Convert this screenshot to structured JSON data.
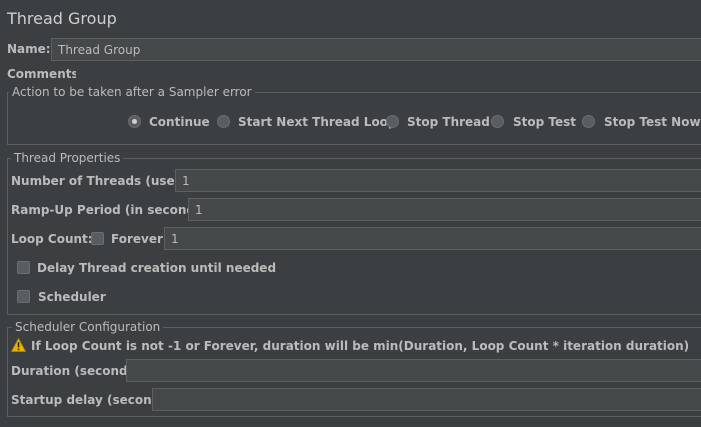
{
  "title": "Thread Group",
  "name_label": "Name:",
  "name_value": "Thread Group",
  "comments_label": "Comments:",
  "comments_value": "",
  "sampler_error": {
    "legend": "Action to be taken after a Sampler error",
    "options": [
      "Continue",
      "Start Next Thread Loop",
      "Stop Thread",
      "Stop Test",
      "Stop Test Now"
    ],
    "selected": "Continue"
  },
  "thread_props": {
    "legend": "Thread Properties",
    "threads_label": "Number of Threads (users):",
    "threads_value": "1",
    "rampup_label": "Ramp-Up Period (in seconds):",
    "rampup_value": "1",
    "loop_label": "Loop Count:",
    "forever_label": "Forever",
    "forever_checked": false,
    "loop_value": "1",
    "delay_label": "Delay Thread creation until needed",
    "delay_checked": false,
    "scheduler_label": "Scheduler",
    "scheduler_checked": false
  },
  "scheduler_config": {
    "legend": "Scheduler Configuration",
    "warning": "If Loop Count is not -1 or Forever, duration will be min(Duration, Loop Count * iteration duration)",
    "duration_label": "Duration (seconds)",
    "duration_value": "",
    "startup_label": "Startup delay (seconds)",
    "startup_value": ""
  },
  "icons": {
    "warning": "warning-icon"
  }
}
